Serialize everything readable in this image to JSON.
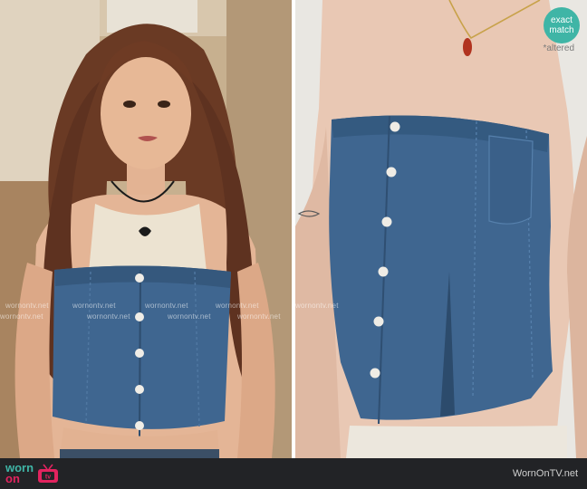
{
  "watermark": {
    "text": "wornontv.net"
  },
  "badge": {
    "line1": "exact",
    "line2": "match",
    "color": "#3fb5a6"
  },
  "altered_label": "*altered",
  "footer": {
    "logo_worn": "worn",
    "logo_on": "on",
    "logo_tv": "tv",
    "site": "WornOnTV.net"
  },
  "colors": {
    "denim": "#3f6690",
    "footer_bg": "#222326",
    "logo_teal": "#3fb5a6",
    "logo_pink": "#e2235f"
  }
}
